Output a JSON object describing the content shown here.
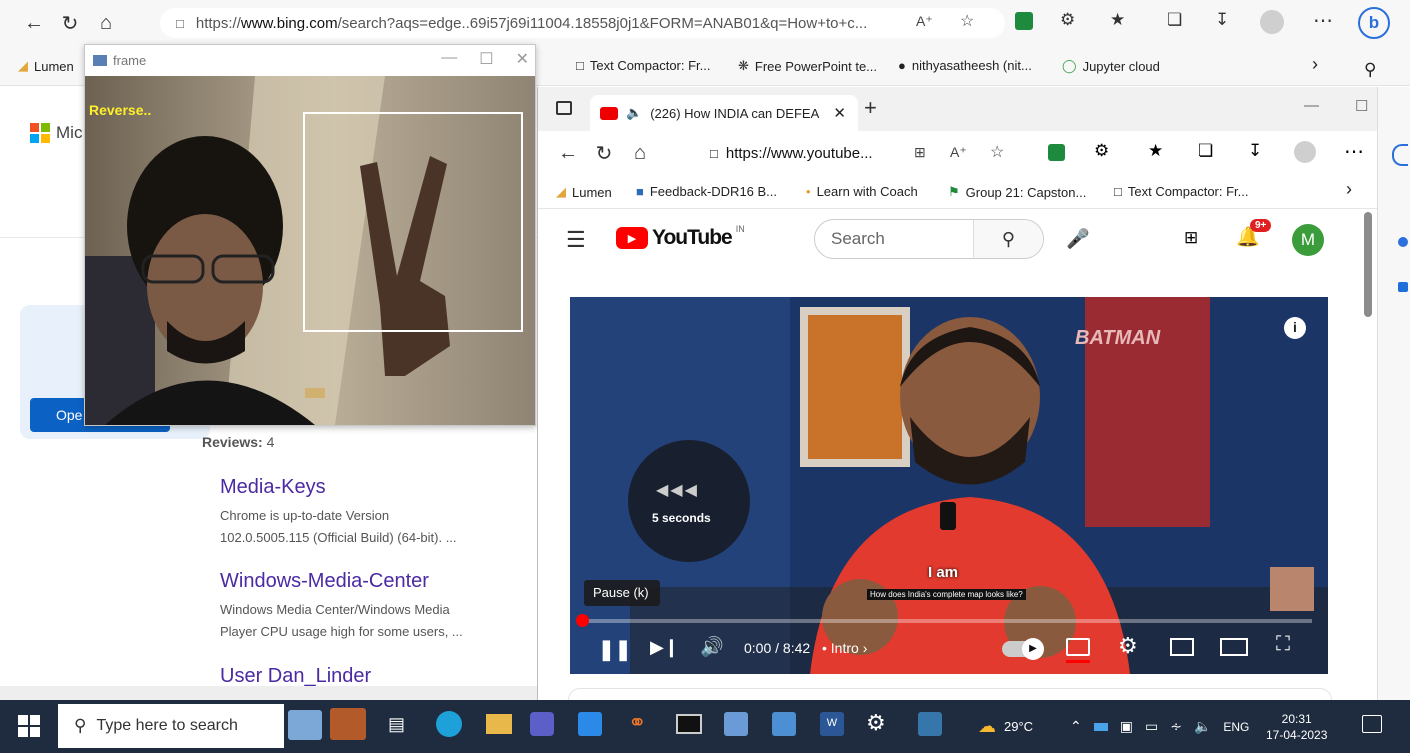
{
  "outer_browser": {
    "url_prefix": "https://",
    "url_host": "www.bing.com",
    "url_rest": "/search?aqs=edge..69i57j69i11004.18558j0j1&FORM=ANAB01&q=How+to+c...",
    "favorites": [
      "Lumen",
      "Text Compactor: Fr...",
      "Free PowerPoint te...",
      "nithyasatheesh (nit...",
      "Jupyter cloud"
    ]
  },
  "frame_window": {
    "title": "frame",
    "overlay_text": "Reverse.."
  },
  "bing": {
    "logo_text": "Mic",
    "open_button": "Ope",
    "reviews_label": "Reviews:",
    "reviews_count": "4",
    "results": [
      {
        "title": "Media-Keys",
        "snippet_1": "Chrome is up-to-date Version",
        "snippet_2": "102.0.5005.115 (Official Build) (64-bit). ..."
      },
      {
        "title": "Windows-Media-Center",
        "snippet_1": "Windows Media Center/Windows Media",
        "snippet_2": "Player CPU usage high for some users, ..."
      },
      {
        "title": "User Dan_Linder",
        "snippet_1": "",
        "snippet_2": ""
      }
    ]
  },
  "youtube_window": {
    "tab_title": "(226) How INDIA can DEFEA",
    "url": "https://www.youtube...",
    "favorites": [
      "Lumen",
      "Feedback-DDR16 B...",
      "Learn with Coach",
      "Group 21: Capston...",
      "Text Compactor: Fr..."
    ],
    "logo_text": "YouTube",
    "region": "IN",
    "search_placeholder": "Search",
    "notifications": "9+",
    "avatar_letter": "M",
    "player": {
      "seek_label": "5 seconds",
      "tooltip": "Pause (k)",
      "caption_small": "How does India's complete map looks like?",
      "caption_big": "I am",
      "time": "0:00 / 8:42",
      "chapter": "• Intro",
      "poster_text": "BATMAN",
      "progress_fraction": 0.0
    }
  },
  "taskbar": {
    "search_placeholder": "Type here to search",
    "weather": "29°C",
    "language": "ENG",
    "time": "20:31",
    "date": "17-04-2023"
  }
}
